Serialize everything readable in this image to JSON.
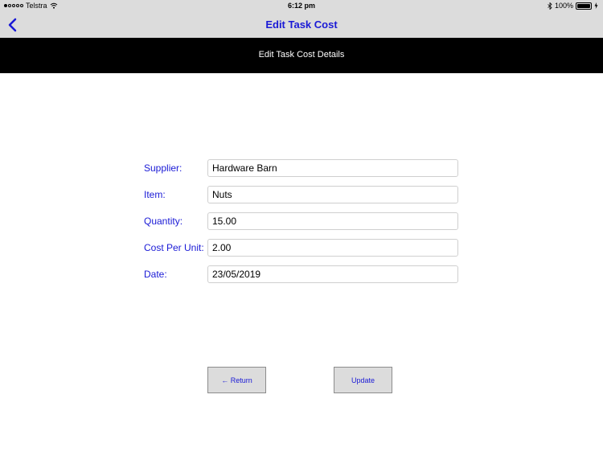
{
  "status_bar": {
    "carrier": "Telstra",
    "time": "6:12 pm",
    "battery": "100%",
    "icons": [
      "signal-dots-icon",
      "wifi-icon",
      "bluetooth-icon",
      "battery-icon",
      "charging-bolt-icon"
    ]
  },
  "nav": {
    "title": "Edit Task Cost",
    "back_icon": "chevron-left-icon"
  },
  "banner": {
    "title": "Edit Task Cost Details"
  },
  "form": {
    "supplier": {
      "label": "Supplier:",
      "value": "Hardware Barn"
    },
    "item": {
      "label": "Item:",
      "value": "Nuts"
    },
    "quantity": {
      "label": "Quantity:",
      "value": "15.00"
    },
    "cost_per_unit": {
      "label": "Cost Per Unit:",
      "value": "2.00"
    },
    "date": {
      "label": "Date:",
      "value": "23/05/2019"
    }
  },
  "buttons": {
    "return_label": "← Return",
    "update_label": "Update"
  },
  "colors": {
    "accent": "#1a1ad6",
    "bar_background": "#dcdcdc",
    "banner_background": "#000000"
  }
}
